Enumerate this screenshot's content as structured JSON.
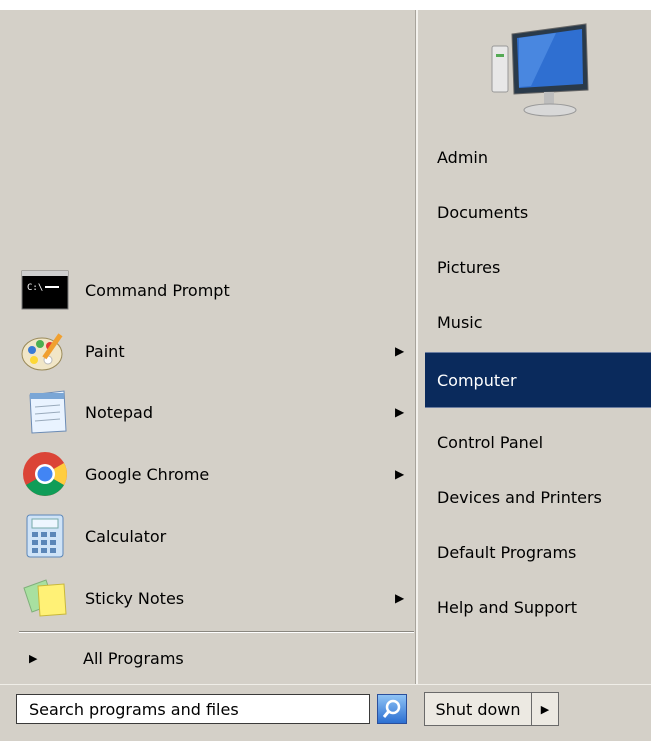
{
  "programs": [
    {
      "label": "Command Prompt",
      "icon": "command-prompt-icon",
      "has_submenu": false
    },
    {
      "label": "Paint",
      "icon": "paint-icon",
      "has_submenu": true
    },
    {
      "label": "Notepad",
      "icon": "notepad-icon",
      "has_submenu": true
    },
    {
      "label": "Google Chrome",
      "icon": "chrome-icon",
      "has_submenu": true
    },
    {
      "label": "Calculator",
      "icon": "calculator-icon",
      "has_submenu": false
    },
    {
      "label": "Sticky Notes",
      "icon": "sticky-notes-icon",
      "has_submenu": true
    }
  ],
  "all_programs": {
    "label": "All Programs"
  },
  "search": {
    "placeholder": "Search programs and files"
  },
  "shutdown": {
    "label": "Shut down"
  },
  "user_picture": {
    "icon": "computer-monitor-icon"
  },
  "right_links": [
    {
      "label": "Admin"
    },
    {
      "label": "Documents"
    },
    {
      "label": "Pictures"
    },
    {
      "label": "Music"
    },
    {
      "label": "Computer",
      "selected": true
    },
    {
      "label": "Control Panel"
    },
    {
      "label": "Devices and Printers"
    },
    {
      "label": "Default Programs"
    },
    {
      "label": "Help and Support"
    }
  ],
  "colors": {
    "selection": "#0a2a5c",
    "menu_bg": "#d4d0c8"
  }
}
